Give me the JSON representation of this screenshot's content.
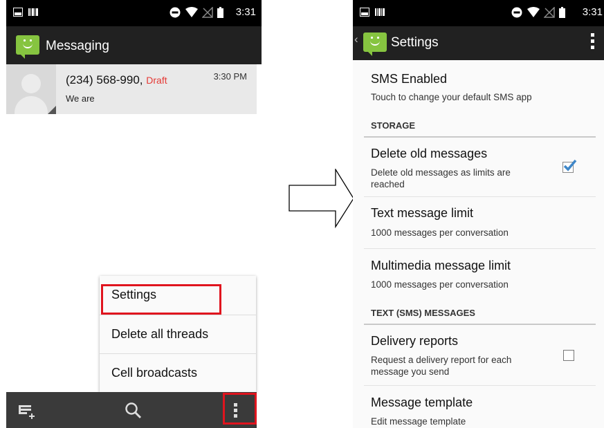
{
  "left_screen": {
    "status_time": "3:31",
    "app_title": "Messaging",
    "thread": {
      "contact": "(234) 568-990,",
      "draft_label": "Draft",
      "time": "3:30 PM",
      "snippet": "We  are"
    },
    "menu_items": [
      "Settings",
      "Delete all threads",
      "Cell broadcasts"
    ],
    "highlight_color": "#e0141e"
  },
  "right_screen": {
    "status_time": "3:31",
    "title": "Settings",
    "sms_enabled": {
      "title": "SMS Enabled",
      "summary": "Touch to change your default SMS app"
    },
    "storage_header": "STORAGE",
    "delete_old": {
      "title": "Delete old messages",
      "summary_line1": "Delete old messages as limits are",
      "summary_line2": "reached",
      "checked": true
    },
    "text_limit": {
      "title": "Text message limit",
      "summary": "1000 messages per conversation"
    },
    "mms_limit": {
      "title": "Multimedia message limit",
      "summary": "1000 messages per conversation"
    },
    "sms_header": "TEXT (SMS) MESSAGES",
    "delivery": {
      "title": "Delivery reports",
      "summary_line1": "Request a delivery report for each",
      "summary_line2": "message you send",
      "checked": false
    },
    "template": {
      "title": "Message template",
      "summary": "Edit message template"
    },
    "accent": "#3f87c8"
  }
}
